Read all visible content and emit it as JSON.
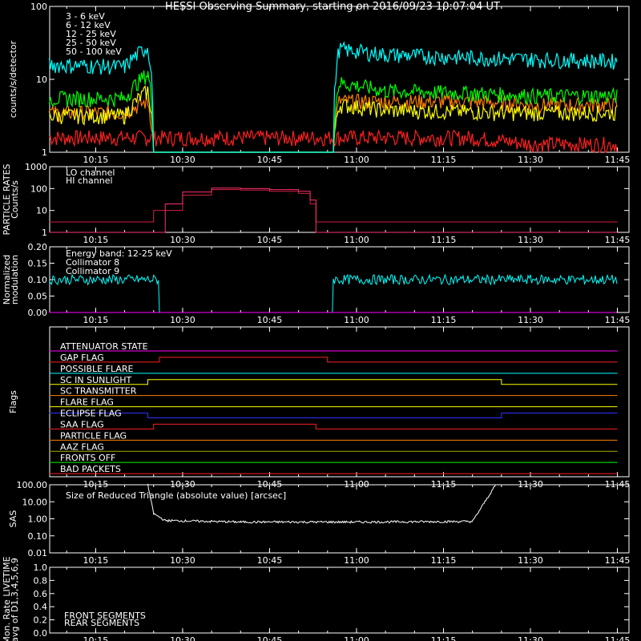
{
  "title": "HESSI Observing Summary, starting on 2016/09/23 10:07:04 UT",
  "colors": {
    "background": "#000000",
    "axes": "#ffffff",
    "red": "#ff2020",
    "orange": "#ff8000",
    "yellow": "#ffff00",
    "green": "#00ff00",
    "cyan": "#00ffff",
    "magenta": "#ff00ff",
    "pink": "#ff3070",
    "crimson": "#d02040",
    "blue": "#3030ff",
    "olive": "#aaaa00",
    "white": "#ffffff"
  },
  "time_ticks": [
    "10:15",
    "10:30",
    "10:45",
    "11:00",
    "11:15",
    "11:30",
    "11:45"
  ],
  "chart_data": [
    {
      "type": "line",
      "panel": "count-rates",
      "ylabel": "counts/s/detector",
      "y_scale": "log",
      "ylim": [
        1,
        100
      ],
      "y_ticks": [
        "1",
        "10",
        "100"
      ],
      "x_unit": "UT",
      "series": [
        {
          "name": "3 - 6 keV",
          "color": "#ff2020",
          "x": [
            "10:07",
            "10:20",
            "10:24",
            "10:25",
            "10:56",
            "10:57",
            "11:05",
            "11:20",
            "11:30",
            "11:45"
          ],
          "y": [
            1.6,
            1.6,
            1.6,
            1.6,
            1.6,
            1.6,
            1.6,
            1.6,
            1.3,
            1.3
          ]
        },
        {
          "name": "6 - 12 keV",
          "color": "#ff8000",
          "x": [
            "10:07",
            "10:20",
            "10:24",
            "10:25",
            "10:56",
            "10:57",
            "11:05",
            "11:20",
            "11:30",
            "11:45"
          ],
          "y": [
            3.5,
            3.5,
            5,
            1,
            1,
            5,
            5,
            5,
            4.5,
            4.5
          ]
        },
        {
          "name": "12 - 25 keV",
          "color": "#ffff00",
          "x": [
            "10:07",
            "10:20",
            "10:24",
            "10:25",
            "10:56",
            "10:57",
            "11:05",
            "11:20",
            "11:30",
            "11:45"
          ],
          "y": [
            3.2,
            3.2,
            7,
            1,
            1,
            4.5,
            3.8,
            3.6,
            3.5,
            3.5
          ]
        },
        {
          "name": "25 - 50 keV",
          "color": "#00ff00",
          "x": [
            "10:07",
            "10:20",
            "10:24",
            "10:25",
            "10:56",
            "10:57",
            "11:05",
            "11:20",
            "11:30",
            "11:45"
          ],
          "y": [
            5.5,
            5.5,
            12,
            1,
            1,
            9,
            7,
            6.5,
            6,
            6
          ]
        },
        {
          "name": "50 - 100 keV",
          "color": "#00ffff",
          "x": [
            "10:07",
            "10:20",
            "10:24",
            "10:25",
            "10:56",
            "10:57",
            "11:05",
            "11:20",
            "11:30",
            "11:45"
          ],
          "y": [
            16,
            15,
            28,
            1,
            1,
            26,
            22,
            20,
            19,
            18
          ]
        }
      ]
    },
    {
      "type": "line",
      "panel": "particle-rates",
      "ylabel": "PARTICLE RATES Counts/s",
      "y_scale": "log",
      "ylim": [
        1,
        1000
      ],
      "y_ticks": [
        "1",
        "10",
        "100",
        "1000"
      ],
      "series": [
        {
          "name": "LO channel",
          "color": "#d02040",
          "x": [
            "10:07",
            "10:23",
            "10:25",
            "10:30",
            "10:35",
            "10:40",
            "10:45",
            "10:50",
            "10:52",
            "10:53",
            "11:45"
          ],
          "y": [
            3,
            3,
            10,
            50,
            90,
            85,
            75,
            60,
            20,
            3,
            3
          ]
        },
        {
          "name": "HI channel",
          "color": "#ff3070",
          "x": [
            "10:07",
            "10:25",
            "10:27",
            "10:30",
            "10:35",
            "10:40",
            "10:45",
            "10:50",
            "10:52",
            "10:53",
            "11:45"
          ],
          "y": [
            1,
            1,
            20,
            70,
            105,
            100,
            90,
            75,
            30,
            1,
            1
          ]
        }
      ]
    },
    {
      "type": "line",
      "panel": "modulation",
      "ylabel": "Normalized modulation",
      "ylim": [
        0.0,
        0.2
      ],
      "y_ticks": [
        "0.00",
        "0.05",
        "0.10",
        "0.15",
        "0.20"
      ],
      "annotation": "Energy band: 12-25 keV",
      "series": [
        {
          "name": "Collimator 8",
          "color": "#00ffff",
          "x": [
            "10:07",
            "10:25",
            "10:26",
            "10:55",
            "10:56",
            "11:45"
          ],
          "y": [
            0.1,
            0.1,
            0.0,
            0.0,
            0.1,
            0.1
          ]
        },
        {
          "name": "Collimator 9",
          "color": "#ff00ff",
          "x": [
            "10:07",
            "11:45"
          ],
          "y": [
            0.0,
            0.0
          ]
        }
      ]
    },
    {
      "type": "line",
      "panel": "flags",
      "ylabel": "Flags",
      "series": [
        {
          "name": "ATTENUATOR STATE",
          "color": "#ff00ff",
          "x": [
            "10:07",
            "11:45"
          ],
          "y": [
            0,
            0
          ]
        },
        {
          "name": "GAP FLAG",
          "color": "#ff2020",
          "x": [
            "10:07",
            "10:26",
            "10:55",
            "11:45"
          ],
          "y": [
            0,
            1,
            0,
            0
          ]
        },
        {
          "name": "POSSIBLE FLARE",
          "color": "#00ffff",
          "x": [
            "10:07",
            "11:45"
          ],
          "y": [
            0,
            0
          ]
        },
        {
          "name": "SC IN SUNLIGHT",
          "color": "#ffff00",
          "x": [
            "10:07",
            "10:24",
            "11:25",
            "11:45"
          ],
          "y": [
            0,
            1,
            0,
            0
          ]
        },
        {
          "name": "SC TRANSMITTER",
          "color": "#ff8000",
          "x": [
            "10:07",
            "11:45"
          ],
          "y": [
            0,
            0
          ]
        },
        {
          "name": "FLARE FLAG",
          "color": "#ffff00",
          "x": [
            "10:07",
            "11:45"
          ],
          "y": [
            0,
            0
          ]
        },
        {
          "name": "ECLIPSE FLAG",
          "color": "#3030ff",
          "x": [
            "10:07",
            "10:24",
            "11:25",
            "11:45"
          ],
          "y": [
            1,
            0,
            1,
            1
          ]
        },
        {
          "name": "SAA FLAG",
          "color": "#ff2020",
          "x": [
            "10:07",
            "10:25",
            "10:53",
            "11:45"
          ],
          "y": [
            0,
            1,
            0,
            0
          ]
        },
        {
          "name": "PARTICLE FLAG",
          "color": "#ff8000",
          "x": [
            "10:07",
            "11:45"
          ],
          "y": [
            0,
            0
          ]
        },
        {
          "name": "AAZ FLAG",
          "color": "#aaaa00",
          "x": [
            "10:07",
            "11:45"
          ],
          "y": [
            0,
            0
          ]
        },
        {
          "name": "FRONTS OFF",
          "color": "#00ff00",
          "x": [
            "10:07",
            "11:45"
          ],
          "y": [
            0,
            0
          ]
        },
        {
          "name": "BAD PACKETS",
          "color": "#ff2020",
          "x": [
            "10:07",
            "11:45"
          ],
          "y": [
            0,
            0
          ]
        }
      ]
    },
    {
      "type": "line",
      "panel": "sas",
      "ylabel": "SAS",
      "y_scale": "log",
      "ylim": [
        0.01,
        100.0
      ],
      "y_ticks": [
        "0.01",
        "0.10",
        "1.00",
        "10.00",
        "100.00"
      ],
      "annotation": "Size of Reduced Triangle (absolute value) [arcsec]",
      "series": [
        {
          "name": "",
          "color": "#ffffff",
          "x": [
            "10:24",
            "10:25",
            "10:27",
            "10:40",
            "11:00",
            "11:20",
            "11:24"
          ],
          "y": [
            100,
            2,
            0.8,
            0.65,
            0.65,
            0.7,
            100
          ]
        }
      ]
    },
    {
      "type": "line",
      "panel": "livetime",
      "ylabel": "Mon. Rate LIVETIME avg of D1,3,4,5,6,9",
      "ylim": [
        0.0,
        1.0
      ],
      "y_ticks": [
        "0.0",
        "0.2",
        "0.4",
        "0.6",
        "0.8",
        "1.0"
      ],
      "series": [
        {
          "name": "FRONT SEGMENTS",
          "color": "#00ff00",
          "x": [],
          "y": []
        },
        {
          "name": "REAR SEGMENTS",
          "color": "#00aa00",
          "x": [],
          "y": []
        }
      ]
    }
  ]
}
